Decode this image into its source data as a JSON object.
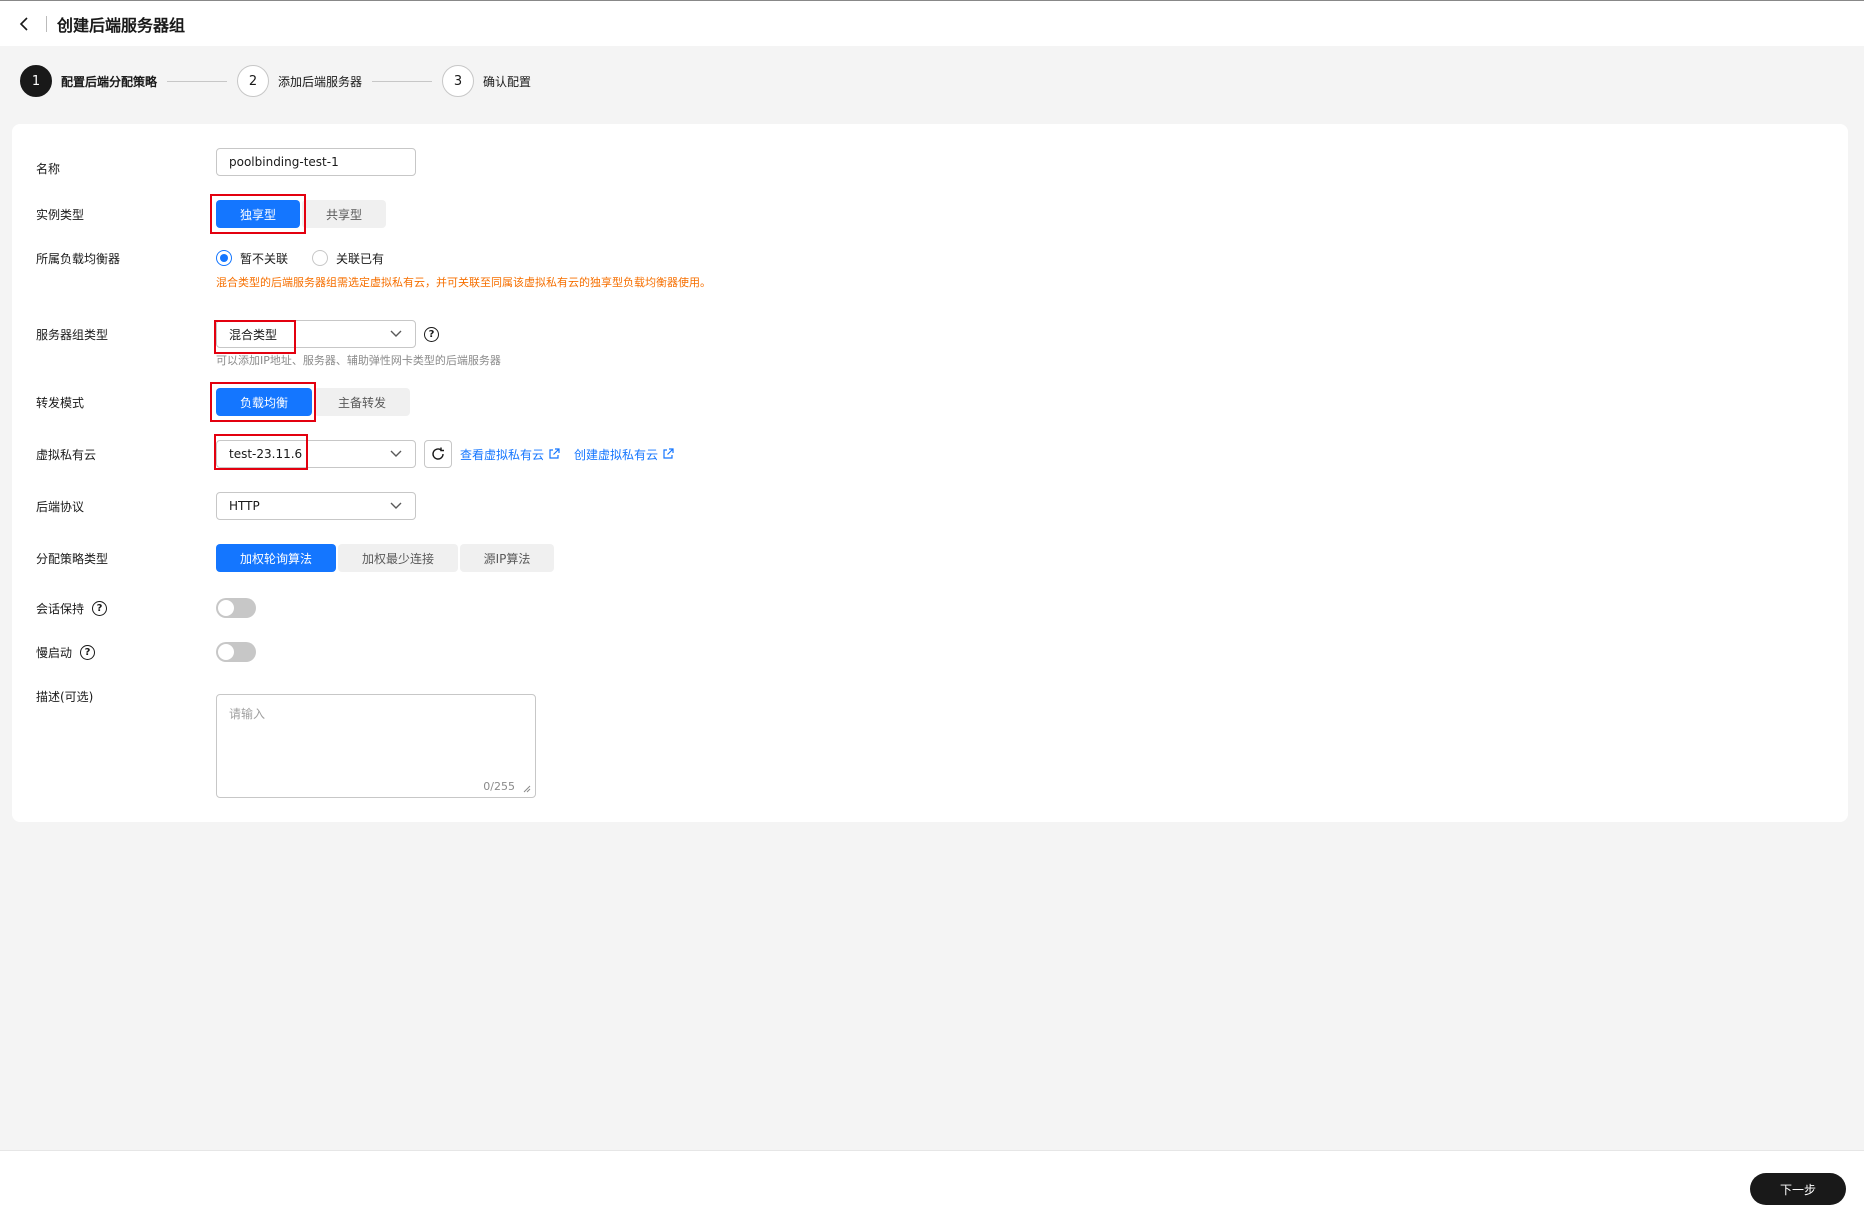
{
  "header": {
    "title": "创建后端服务器组"
  },
  "steps": [
    {
      "num": "1",
      "label": "配置后端分配策略"
    },
    {
      "num": "2",
      "label": "添加后端服务器"
    },
    {
      "num": "3",
      "label": "确认配置"
    }
  ],
  "form": {
    "name": {
      "label": "名称",
      "value": "poolbinding-test-1"
    },
    "instance_type": {
      "label": "实例类型",
      "options": [
        "独享型",
        "共享型"
      ],
      "selected": "独享型"
    },
    "load_balancer": {
      "label": "所属负载均衡器",
      "options": [
        "暂不关联",
        "关联已有"
      ],
      "selected": "暂不关联",
      "warning": "混合类型的后端服务器组需选定虚拟私有云，并可关联至同属该虚拟私有云的独享型负载均衡器使用。"
    },
    "server_group_type": {
      "label": "服务器组类型",
      "value": "混合类型",
      "hint": "可以添加IP地址、服务器、辅助弹性网卡类型的后端服务器"
    },
    "forward_mode": {
      "label": "转发模式",
      "options": [
        "负载均衡",
        "主备转发"
      ],
      "selected": "负载均衡"
    },
    "vpc": {
      "label": "虚拟私有云",
      "value": "test-23.11.6",
      "link_view": "查看虚拟私有云",
      "link_create": "创建虚拟私有云"
    },
    "backend_protocol": {
      "label": "后端协议",
      "value": "HTTP"
    },
    "algorithm": {
      "label": "分配策略类型",
      "options": [
        "加权轮询算法",
        "加权最少连接",
        "源IP算法"
      ],
      "selected": "加权轮询算法"
    },
    "sticky_session": {
      "label": "会话保持",
      "enabled": false
    },
    "slow_start": {
      "label": "慢启动",
      "enabled": false
    },
    "description": {
      "label": "描述(可选)",
      "placeholder": "请输入",
      "counter": "0/255"
    }
  },
  "footer": {
    "next_label": "下一步"
  },
  "colors": {
    "primary": "#1476ff",
    "warning": "#f66f00",
    "highlight": "#e3000f"
  }
}
